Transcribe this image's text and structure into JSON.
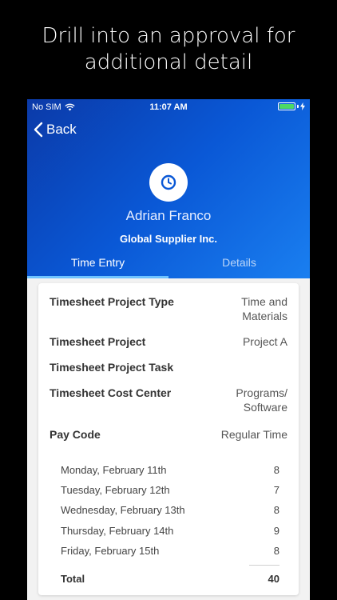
{
  "promo": {
    "line1": "Drill into an approval for",
    "line2": "additional detail"
  },
  "status_bar": {
    "carrier": "No SIM",
    "time": "11:07 AM",
    "battery_color": "#4cd964"
  },
  "nav": {
    "back_label": "Back"
  },
  "profile": {
    "icon": "clock-icon",
    "name": "Adrian Franco",
    "company": "Global Supplier Inc."
  },
  "tabs": [
    {
      "label": "Time Entry",
      "active": true
    },
    {
      "label": "Details",
      "active": false
    }
  ],
  "fields": [
    {
      "label": "Timesheet Project Type",
      "value_line1": "Time and",
      "value_line2": "Materials"
    },
    {
      "label": "Timesheet Project",
      "value_line1": "Project A",
      "value_line2": ""
    },
    {
      "label": "Timesheet Project Task",
      "value_line1": "",
      "value_line2": ""
    },
    {
      "label": "Timesheet Cost Center",
      "value_line1": "Programs/",
      "value_line2": "Software"
    },
    {
      "label": "Pay Code",
      "value_line1": "Regular Time",
      "value_line2": ""
    }
  ],
  "days": [
    {
      "day": "Monday, February 11th",
      "hours": "8"
    },
    {
      "day": "Tuesday, February 12th",
      "hours": "7"
    },
    {
      "day": "Wednesday, February 13th",
      "hours": "8"
    },
    {
      "day": "Thursday, February 14th",
      "hours": "9"
    },
    {
      "day": "Friday, February 15th",
      "hours": "8"
    }
  ],
  "total": {
    "label": "Total",
    "value": "40"
  },
  "colors": {
    "header_start": "#0b3aa8",
    "header_end": "#1a7ff0",
    "tab_indicator": "#6fc3ff"
  }
}
